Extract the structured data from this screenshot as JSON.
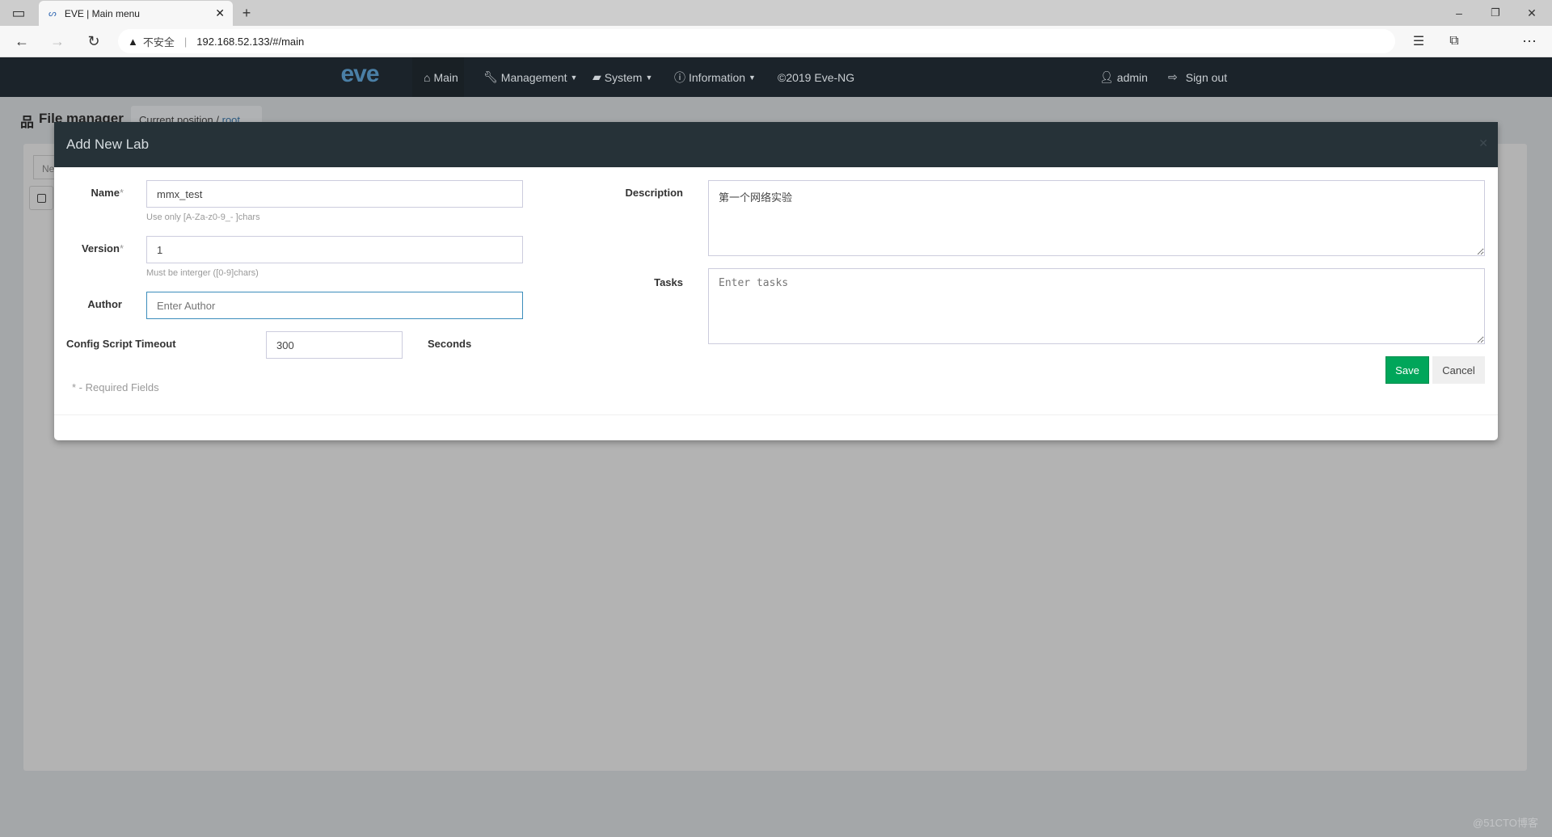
{
  "browser": {
    "tab_title": "EVE | Main menu",
    "security_label": "不安全",
    "url": "192.168.52.133/#/main"
  },
  "navbar": {
    "items": [
      {
        "label": "Main",
        "icon": "home-icon"
      },
      {
        "label": "Management",
        "icon": "wrench-icon"
      },
      {
        "label": "System",
        "icon": "book-icon"
      },
      {
        "label": "Information",
        "icon": "info-icon"
      }
    ],
    "copyright": "©2019 Eve-NG",
    "user": "admin",
    "signout": "Sign out"
  },
  "page": {
    "title": "File manager",
    "breadcrumb_label": "Current position",
    "breadcrumb_root": "root",
    "new_button": "Ne"
  },
  "modal": {
    "title": "Add New Lab",
    "name": {
      "label": "Name",
      "value": "mmx_test",
      "help": "Use only [A-Za-z0-9_- ]chars"
    },
    "version": {
      "label": "Version",
      "value": "1",
      "help": "Must be interger ([0-9]chars)"
    },
    "author": {
      "label": "Author",
      "placeholder": "Enter Author"
    },
    "timeout": {
      "label": "Config Script Timeout",
      "value": "300",
      "unit": "Seconds"
    },
    "required_note": "* - Required Fields",
    "description": {
      "label": "Description",
      "value": "第一个网络实验"
    },
    "tasks": {
      "label": "Tasks",
      "placeholder": "Enter tasks"
    },
    "save": "Save",
    "cancel": "Cancel",
    "accent": "#00a65a"
  },
  "watermark": "@51CTO博客"
}
